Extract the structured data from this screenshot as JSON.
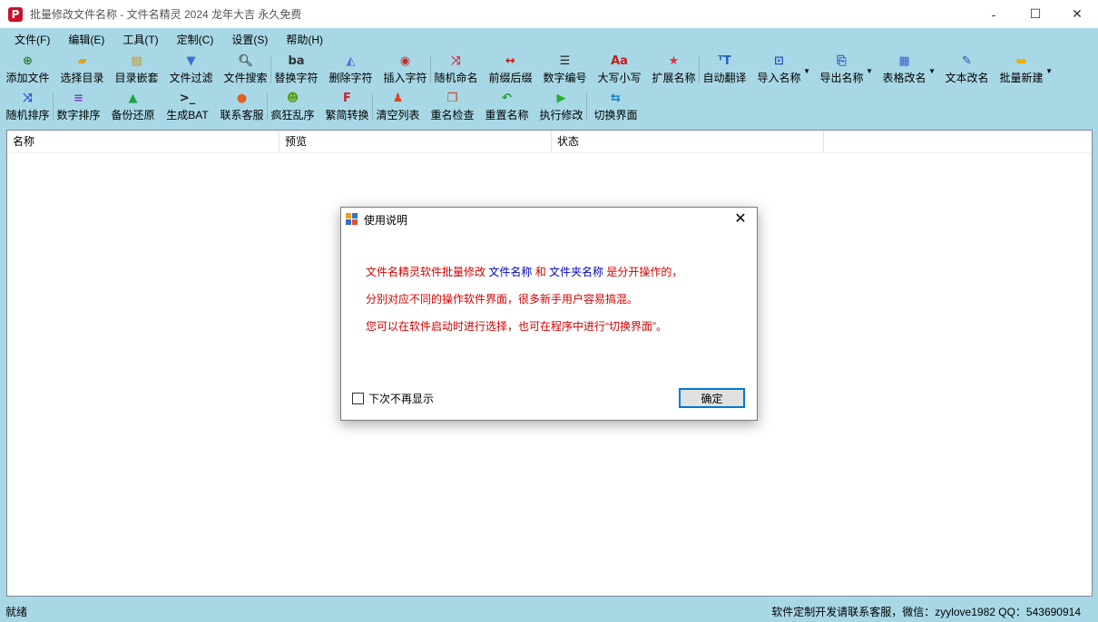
{
  "window": {
    "title": "批量修改文件名称 -  文件名精灵 2024 龙年大吉 永久免费",
    "app_icon_glyph": "P",
    "controls": {
      "minimize": "-",
      "maximize": "☐",
      "close": "✕"
    }
  },
  "menu": [
    "文件(F)",
    "编辑(E)",
    "工具(T)",
    "定制(C)",
    "设置(S)",
    "帮助(H)"
  ],
  "toolbar_row1": [
    {
      "label": "添加文件",
      "icon": "add-file-icon",
      "glyph": "⊕",
      "color": "#2e7d32"
    },
    {
      "label": "选择目录",
      "icon": "open-folder-icon",
      "glyph": "▰",
      "color": "#e0a020"
    },
    {
      "label": "目录嵌套",
      "icon": "nested-folder-icon",
      "glyph": "▤",
      "color": "#c89020"
    },
    {
      "label": "文件过滤",
      "icon": "filter-icon",
      "glyph": "▼",
      "color": "#3a6fd8"
    },
    {
      "label": "文件搜索",
      "icon": "search-icon",
      "glyph": "🔍︎",
      "color": "#555555"
    },
    {
      "label": "替换字符",
      "icon": "replace-text-icon",
      "glyph": "ba",
      "color": "#333333"
    },
    {
      "label": "删除字符",
      "icon": "erase-text-icon",
      "glyph": "◭",
      "color": "#5a6fd8"
    },
    {
      "label": "插入字符",
      "icon": "insert-text-icon",
      "glyph": "◉",
      "color": "#c03030"
    },
    {
      "label": "随机命名",
      "icon": "shuffle-icon",
      "glyph": "⤨",
      "color": "#d03050"
    },
    {
      "label": "前缀后缀",
      "icon": "prefix-suffix-icon",
      "glyph": "↔",
      "color": "#c02020"
    },
    {
      "label": "数字编号",
      "icon": "numbered-list-icon",
      "glyph": "☰",
      "color": "#222222"
    },
    {
      "label": "大写小写",
      "icon": "case-icon",
      "glyph": "Aa",
      "color": "#c02020"
    },
    {
      "label": "扩展名称",
      "icon": "star-icon",
      "glyph": "★",
      "color": "#e03040"
    },
    {
      "label": "自动翻译",
      "icon": "translate-icon",
      "glyph": "ᵀT",
      "color": "#2060c0"
    },
    {
      "label": "导入名称",
      "icon": "import-icon",
      "glyph": "⊡",
      "color": "#3050c0"
    },
    {
      "label": "导出名称",
      "icon": "export-icon",
      "glyph": "⎘",
      "color": "#3050c0"
    },
    {
      "label": "表格改名",
      "icon": "table-icon",
      "glyph": "▦",
      "color": "#3060d0"
    },
    {
      "label": "文本改名",
      "icon": "edit-text-icon",
      "glyph": "✎",
      "color": "#2050b0"
    },
    {
      "label": "批量新建",
      "icon": "new-folder-icon",
      "glyph": "▬",
      "color": "#f0b000"
    }
  ],
  "toolbar_row2": [
    {
      "label": "随机排序",
      "icon": "random-sort-icon",
      "glyph": "⤨",
      "color": "#3050d0"
    },
    {
      "label": "数字排序",
      "icon": "sort-list-icon",
      "glyph": "≡",
      "color": "#8040c0"
    },
    {
      "label": "备份还原",
      "icon": "backup-icon",
      "glyph": "▲",
      "color": "#20a040"
    },
    {
      "label": "生成BAT",
      "icon": "terminal-icon",
      "glyph": ">_",
      "color": "#222222"
    },
    {
      "label": "联系客服",
      "icon": "support-icon",
      "glyph": "●",
      "color": "#e06020"
    },
    {
      "label": "疯狂乱序",
      "icon": "crazy-face-icon",
      "glyph": "☻",
      "color": "#60a020"
    },
    {
      "label": "繁简转换",
      "icon": "convert-icon",
      "glyph": "F",
      "color": "#d02020"
    },
    {
      "label": "清空列表",
      "icon": "clear-list-icon",
      "glyph": "♟",
      "color": "#e04020"
    },
    {
      "label": "重名检查",
      "icon": "duplicate-check-icon",
      "glyph": "❐",
      "color": "#d04020"
    },
    {
      "label": "重置名称",
      "icon": "undo-icon",
      "glyph": "↶",
      "color": "#20a030"
    },
    {
      "label": "执行修改",
      "icon": "run-icon",
      "glyph": "▶",
      "color": "#20b030"
    },
    {
      "label": "切换界面",
      "icon": "switch-icon",
      "glyph": "⇆",
      "color": "#1080d0"
    }
  ],
  "list": {
    "columns": [
      "名称",
      "预览",
      "状态"
    ],
    "rows": []
  },
  "status": {
    "left": "就绪",
    "right": "软件定制开发请联系客服，微信：zyylove1982   QQ：543690914"
  },
  "dialog": {
    "title": "使用说明",
    "close": "✕",
    "line1": {
      "a": "文件名精灵软件批量修改 ",
      "b": "文件名称",
      "c": " 和 ",
      "d": "文件夹名称",
      "e": " 是分开操作的，"
    },
    "line2": "分别对应不同的操作软件界面，很多新手用户容易搞混。",
    "line3": "您可以在软件启动时进行选择，也可在程序中进行“切换界面”。",
    "checkbox_label": "下次不再显示",
    "ok_label": "确定"
  }
}
